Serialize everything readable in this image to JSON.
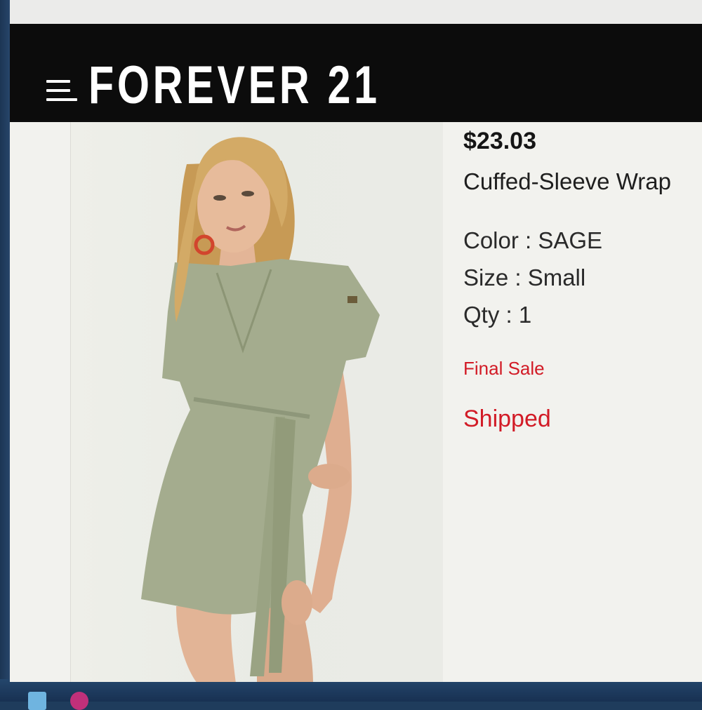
{
  "header": {
    "brand": "FOREVER 21",
    "menu_icon": "hamburger-menu-icon"
  },
  "product": {
    "price": "$23.03",
    "title": "Cuffed-Sleeve Wrap",
    "color_row": "Color : SAGE",
    "size_row": "Size : Small",
    "qty_row": "Qty : 1",
    "final_sale": "Final Sale",
    "status": "Shipped"
  },
  "colors": {
    "header_bg": "#0c0c0c",
    "accent_red": "#d21b26",
    "dress": "#a3ab8c"
  }
}
